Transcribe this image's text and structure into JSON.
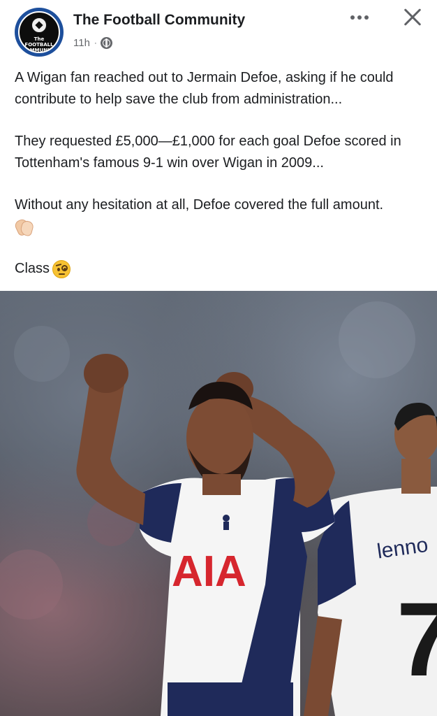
{
  "post": {
    "page_name": "The Football Community",
    "avatar_text": "The FOOTBALL\nCOMMUNITY",
    "time": "11h",
    "paragraphs": [
      "A Wigan fan reached out to Jermain Defoe, asking if he could contribute to help save the club from administration...",
      "They requested £5,000—£1,000 for each goal Defoe scored in Tottenham's famous 9-1 win over Wigan in 2009...",
      "Without any hesitation at all, Defoe covered the full amount.",
      "Class"
    ],
    "icons": {
      "privacy": "globe-icon",
      "more": "more-options-icon",
      "close": "close-icon",
      "emoji_1": "clapping-hands-emoji",
      "emoji_2": "face-with-monocle-emoji"
    }
  },
  "image": {
    "sponsor_text": "AIA",
    "name_on_shirt": "lenno",
    "number_on_shirt": "7"
  },
  "colors": {
    "avatar_ring": "#1d4f9c",
    "text_primary": "#1c1e21",
    "text_secondary": "#65676b",
    "jersey_navy": "#1f2a5a",
    "sponsor_red": "#d6262e"
  }
}
